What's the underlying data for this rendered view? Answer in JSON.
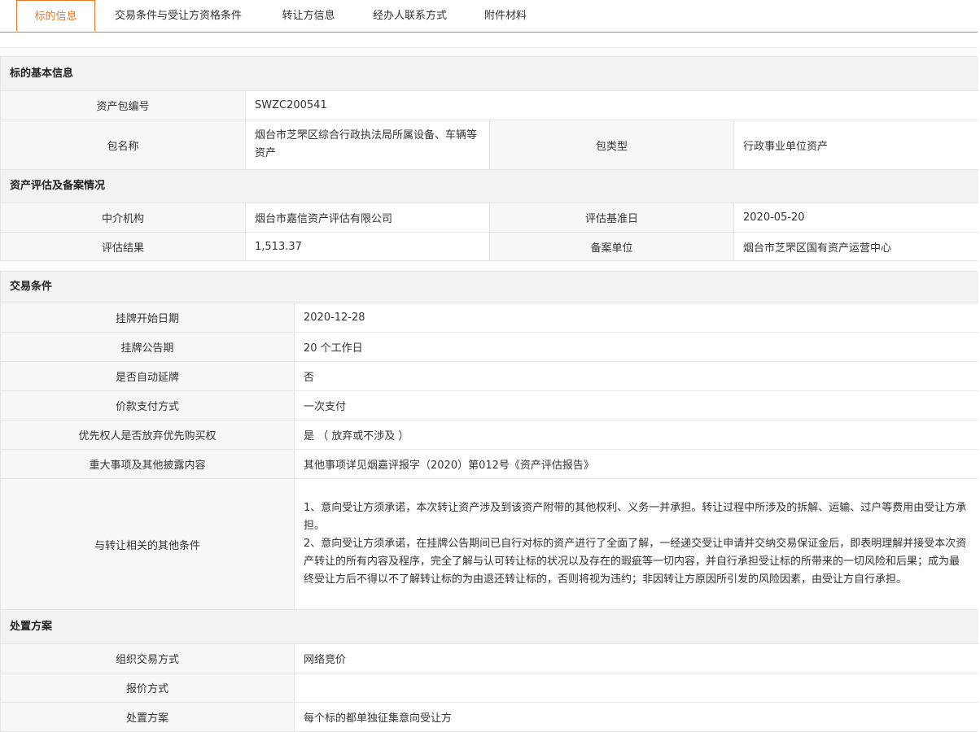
{
  "tabs": [
    {
      "label": "标的信息",
      "active": true
    },
    {
      "label": "交易条件与受让方资格条件",
      "active": false
    },
    {
      "label": "转让方信息",
      "active": false
    },
    {
      "label": "经办人联系方式",
      "active": false
    },
    {
      "label": "附件材料",
      "active": false
    }
  ],
  "basic": {
    "title": "标的基本信息",
    "pkg_no_label": "资产包编号",
    "pkg_no": "SWZC200541",
    "pkg_name_label": "包名称",
    "pkg_name": "烟台市芝罘区综合行政执法局所属设备、车辆等资产",
    "pkg_type_label": "包类型",
    "pkg_type": "行政事业单位资产"
  },
  "eval": {
    "title": "资产评估及备案情况",
    "agency_label": "中介机构",
    "agency": "烟台市嘉信资产评估有限公司",
    "base_date_label": "评估基准日",
    "base_date": "2020-05-20",
    "result_label": "评估结果",
    "result": "1,513.37",
    "record_unit_label": "备案单位",
    "record_unit": "烟台市芝罘区国有资产运营中心"
  },
  "trade": {
    "title": "交易条件",
    "rows": [
      {
        "label": "挂牌开始日期",
        "value": "2020-12-28"
      },
      {
        "label": "挂牌公告期",
        "value": "20 个工作日"
      },
      {
        "label": "是否自动延牌",
        "value": "否"
      },
      {
        "label": "价款支付方式",
        "value": "一次支付"
      },
      {
        "label": "优先权人是否放弃优先购买权",
        "value": "是 （ 放弃或不涉及 ）"
      },
      {
        "label": "重大事项及其他披露内容",
        "value": "其他事项详见烟嘉评报字（2020）第012号《资产评估报告》"
      }
    ],
    "other_label": "与转让相关的其他条件",
    "other_p1": "1、意向受让方须承诺，本次转让资产涉及到该资产附带的其他权利、义务一并承担。转让过程中所涉及的拆解、运输、过户等费用由受让方承担。",
    "other_p2": "2、意向受让方须承诺，在挂牌公告期间已自行对标的资产进行了全面了解，一经递交受让申请并交纳交易保证金后，即表明理解并接受本次资产转让的所有内容及程序，完全了解与认可转让标的状况以及存在的瑕疵等一切内容，并自行承担受让标的所带来的一切风险和后果；成为最终受让方后不得以不了解转让标的为由退还转让标的，否则将视为违约；非因转让方原因所引发的风险因素，由受让方自行承担。"
  },
  "disposal": {
    "title": "处置方案",
    "rows": [
      {
        "label": "组织交易方式",
        "value": "网络竞价"
      },
      {
        "label": "报价方式",
        "value": ""
      },
      {
        "label": "处置方案",
        "value": "每个标的都单独征集意向受让方"
      }
    ]
  },
  "colors": {
    "accent": "#e57a2b",
    "label_bg": "#f7f7f7",
    "title_bg": "#f2f2f2",
    "border": "#e6e6e6"
  }
}
